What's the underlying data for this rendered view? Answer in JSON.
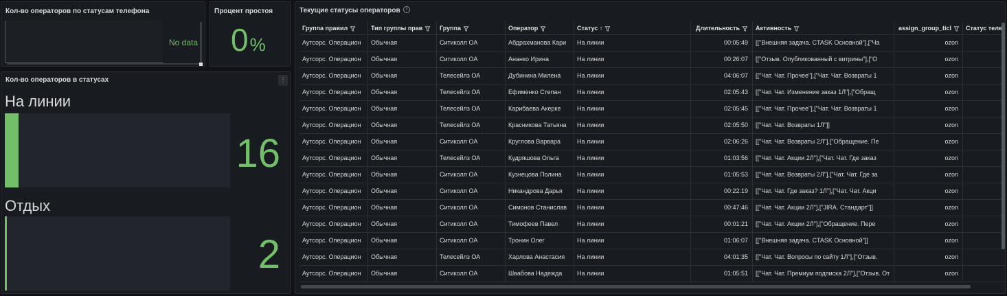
{
  "colors": {
    "accent_green": "#73bf69",
    "panel_bg": "#181b1f",
    "page_bg": "#111217"
  },
  "phone_panel": {
    "title": "Кол-во операторов по статусам телефона",
    "empty_text": "No data"
  },
  "idle_panel": {
    "title": "Процент простоя",
    "value": "0",
    "unit": "%"
  },
  "status_panel": {
    "title": "Кол-во операторов в статусах",
    "menu_icon": "kebab-menu-icon",
    "gauges": [
      {
        "label": "На линии",
        "value": "16",
        "fill": 0.06
      },
      {
        "label": "Отдых",
        "value": "2",
        "fill": 0.008
      }
    ]
  },
  "table_panel": {
    "title": "Текущие статусы операторов",
    "info_icon": "info-icon",
    "columns": [
      {
        "label": "Группа правил",
        "filter_icon": "filter-icon"
      },
      {
        "label": "Тип группы прав",
        "filter_icon": "filter-icon"
      },
      {
        "label": "Группа",
        "filter_icon": "filter-icon"
      },
      {
        "label": "Оператор",
        "filter_icon": "filter-icon"
      },
      {
        "label": "Статус",
        "sort": "↑",
        "filter_icon": "filter-icon"
      },
      {
        "label": "Длительность",
        "filter_icon": "filter-icon"
      },
      {
        "label": "Активность",
        "filter_icon": "filter-icon"
      },
      {
        "label": "assign_group_ticl",
        "filter_icon": "filter-icon"
      },
      {
        "label": "Статус теле"
      }
    ],
    "rows": [
      [
        "Аутсорс. Операцион",
        "Обычная",
        "Ситиколл ОА",
        "Абдрахманова Кари",
        "На линии",
        "00:05:49",
        "[[\"Внешняя задача. CTASK Основной\"],[\"Ча",
        "ozon"
      ],
      [
        "Аутсорс. Операцион",
        "Обычная",
        "Ситиколл ОА",
        "Ананко Ирина",
        "На линии",
        "00:26:07",
        "[[\"Отзыв. Опубликованный с витрины\"],[\"О",
        "ozon"
      ],
      [
        "Аутсорс. Операцион",
        "Обычная",
        "Телесейлз ОА",
        "Дубинина Милена",
        "На линии",
        "04:06:07",
        "[[\"Чат. Чат. Прочее\"],[\"Чат. Чат. Возвраты 1",
        "ozon"
      ],
      [
        "Аутсорс. Операцион",
        "Обычная",
        "Телесейлз ОА",
        "Ефименко Степан",
        "На линии",
        "02:05:43",
        "[[\"Чат. Чат. Изменение заказ 1Л\"],[\"Обращ",
        "ozon"
      ],
      [
        "Аутсорс. Операцион",
        "Обычная",
        "Телесейлз ОА",
        "Карибаева Акерке",
        "На линии",
        "02:05:45",
        "[[\"Чат. Чат. Прочее\"],[\"Чат. Чат. Возвраты 1",
        "ozon"
      ],
      [
        "Аутсорс. Операцион",
        "Обычная",
        "Телесейлз ОА",
        "Красникова Татьяна",
        "На линии",
        "02:05:50",
        "[[\"Чат. Чат. Возвраты 1Л\"]]",
        "ozon"
      ],
      [
        "Аутсорс. Операцион",
        "Обычная",
        "Ситиколл ОА",
        "Круглова Варвара",
        "На линии",
        "02:06:26",
        "[[\"Чат. Чат. Возвраты 2Л\"],[\"Обращение. Пе",
        "ozon"
      ],
      [
        "Аутсорс. Операцион",
        "Обычная",
        "Телесейлз ОА",
        "Кудряшова Ольга",
        "На линии",
        "01:03:56",
        "[[\"Чат. Чат. Акции 2Л\"],[\"Чат. Чат. Где заказ",
        "ozon"
      ],
      [
        "Аутсорс. Операцион",
        "Обычная",
        "Ситиколл ОА",
        "Кузнецова Полина",
        "На линии",
        "01:05:53",
        "[[\"Чат. Чат. Возвраты 2Л\"],[\"Чат. Чат. Где за",
        "ozon"
      ],
      [
        "Аутсорс. Операцион",
        "Обычная",
        "Ситиколл ОА",
        "Никандрова Дарья",
        "На линии",
        "00:22:19",
        "[[\"Чат. Чат. Где заказ? 1Л\"],[\"Чат. Чат. Акци",
        "ozon"
      ],
      [
        "Аутсорс. Операцион",
        "Обычная",
        "Ситиколл ОА",
        "Симонов Станислав",
        "На линии",
        "00:47:46",
        "[[\"Чат. Чат. Акции 2Л\"],[\"JIRA. Стандарт\"]]",
        "ozon"
      ],
      [
        "Аутсорс. Операцион",
        "Обычная",
        "Ситиколл ОА",
        "Тимофеев Павел",
        "На линии",
        "00:01:21",
        "[[\"Чат. Чат. Акции 2Л\"],[\"Обращение. Пере",
        "ozon"
      ],
      [
        "Аутсорс. Операцион",
        "Обычная",
        "Ситиколл ОА",
        "Тронин Олег",
        "На линии",
        "01:06:07",
        "[[\"Внешняя задача. CTASK Основной\"]]",
        "ozon"
      ],
      [
        "Аутсорс. Операцион",
        "Обычная",
        "Телесейлз ОА",
        "Харлова Анастасия",
        "На линии",
        "04:01:35",
        "[[\"Чат. Чат. Вопросы по сайту 1Л\"],[\"Отзыв.",
        "ozon"
      ],
      [
        "Аутсорс. Операцион",
        "Обычная",
        "Ситиколл ОА",
        "Швабова Надежда",
        "На линии",
        "01:05:51",
        "[[\"Чат. Чат. Премиум подписка 2Л\"],[\"Отзыв. От",
        "ozon"
      ]
    ]
  }
}
